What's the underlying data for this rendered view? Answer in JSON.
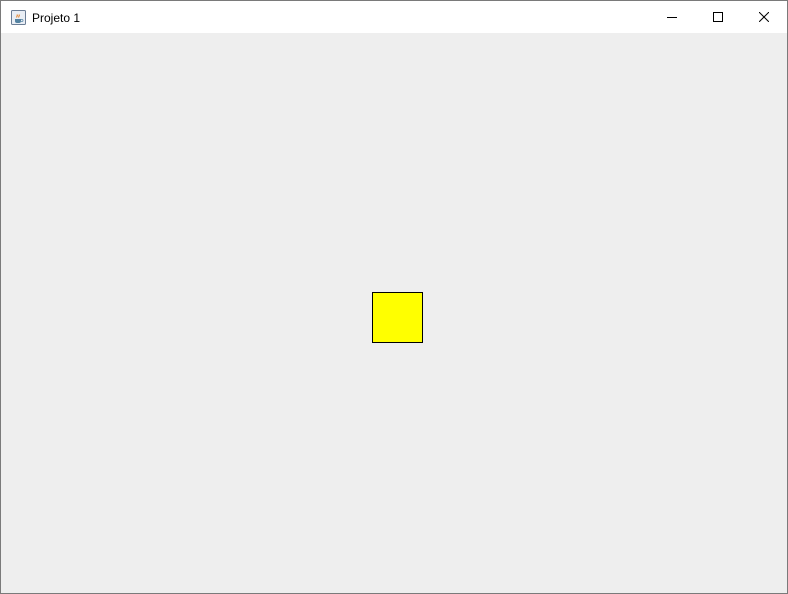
{
  "window": {
    "title": "Projeto 1"
  },
  "titlebar": {
    "app_icon": "java-cup-icon",
    "controls": {
      "minimize_icon": "minimize-icon",
      "maximize_icon": "maximize-icon",
      "close_icon": "close-icon"
    }
  },
  "canvas": {
    "background_color": "#eeeeee",
    "shape": {
      "type": "square",
      "fill_color": "#ffff00",
      "border_color": "#000000"
    }
  }
}
